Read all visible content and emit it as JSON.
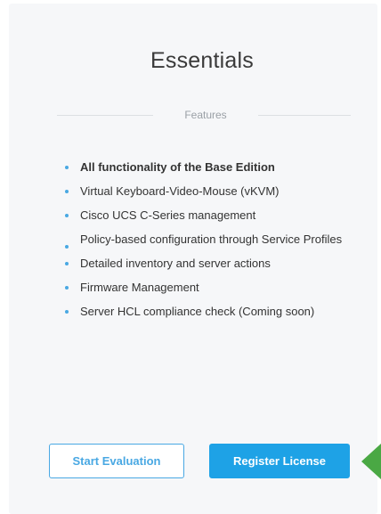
{
  "card": {
    "title": "Essentials",
    "section_label": "Features",
    "features": [
      "All functionality of the Base Edition",
      "Virtual Keyboard-Video-Mouse (vKVM)",
      "Cisco UCS C-Series management",
      "Policy-based configuration through Service Profiles",
      "Detailed inventory and server actions",
      "Firmware Management",
      "Server HCL compliance check (Coming soon)"
    ],
    "buttons": {
      "start_evaluation": "Start Evaluation",
      "register_license": "Register License"
    }
  },
  "colors": {
    "accent": "#1ea2e6",
    "bullet": "#49a8e3",
    "pointer_arrow": "#4aa844",
    "card_background": "#f6f7f9"
  },
  "icons": {
    "pointer": "arrow-left-icon",
    "bullet": "bullet-dot-icon"
  }
}
